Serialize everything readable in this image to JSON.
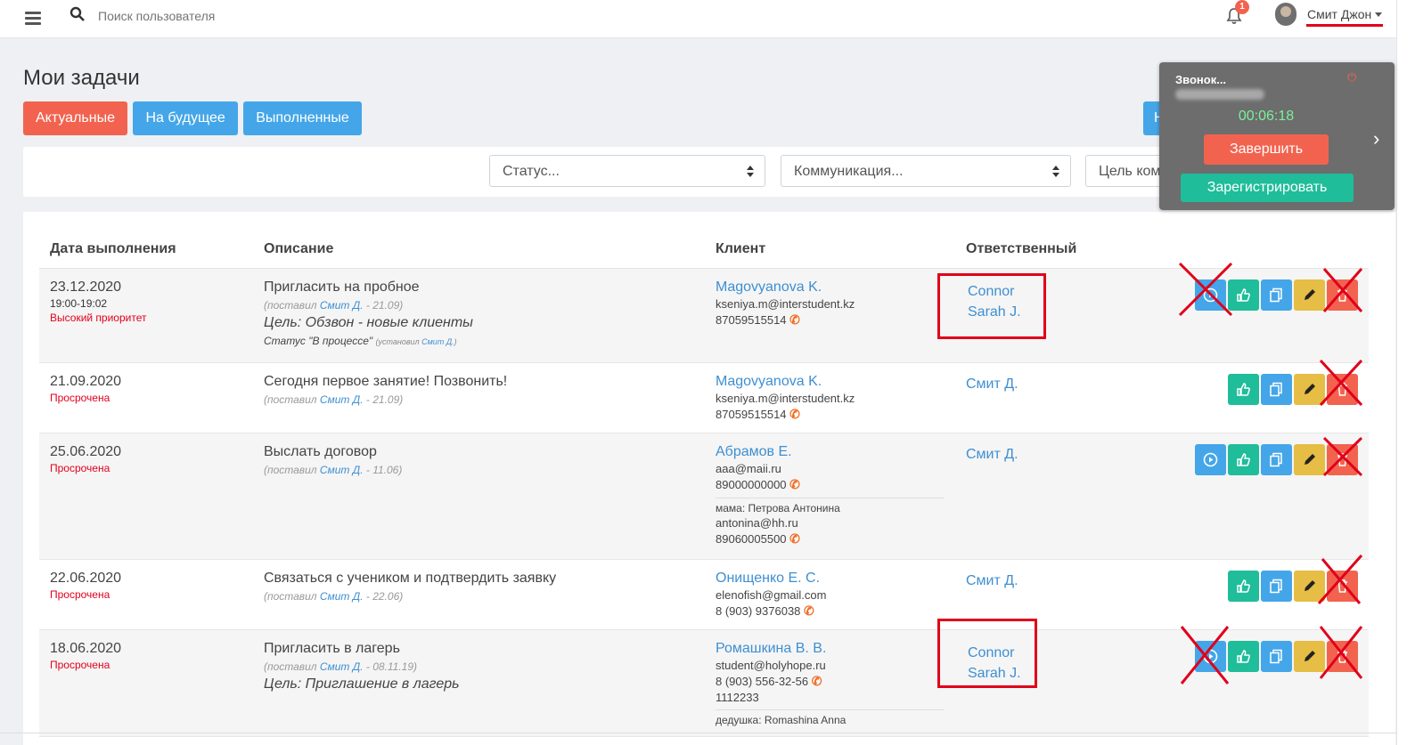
{
  "topbar": {
    "search_placeholder": "Поиск пользователя",
    "notification_count": "1",
    "username": "Смит Джон"
  },
  "page": {
    "title": "Мои задачи"
  },
  "tabs": [
    {
      "label": "Актуальные"
    },
    {
      "label": "На будущее"
    },
    {
      "label": "Выполненные"
    }
  ],
  "hidden_button_label": "Н",
  "filters": {
    "status": "Статус...",
    "communication": "Коммуникация...",
    "goal": "Цель ком"
  },
  "table": {
    "headers": {
      "date": "Дата выполнения",
      "description": "Описание",
      "client": "Клиент",
      "responsible": "Ответственный"
    },
    "rows": [
      {
        "date": "23.12.2020",
        "time": "19:00-19:02",
        "label": "Высокий приоритет",
        "desc": "Пригласить на пробное",
        "meta_prefix": "(поставил ",
        "meta_author": "Смит Д.",
        "meta_suffix": " - 21.09)",
        "goal": "Цель: Обзвон - новые клиенты",
        "status_text": "Статус \"В процессе\"",
        "status_note_prefix": "(установил ",
        "status_note_author": "Смит Д.",
        "status_note_suffix": ")",
        "client_name": "Magovyanova K.",
        "client_email": "kseniya.m@interstudent.kz",
        "client_phone": "87059515514",
        "responsible": [
          "Connor",
          "Sarah J."
        ]
      },
      {
        "date": "21.09.2020",
        "label": "Просрочена",
        "desc": "Сегодня первое занятие! Позвонить!",
        "meta_prefix": "(поставил ",
        "meta_author": "Смит Д.",
        "meta_suffix": " - 21.09)",
        "client_name": "Magovyanova K.",
        "client_email": "kseniya.m@interstudent.kz",
        "client_phone": "87059515514",
        "responsible": [
          "Смит Д."
        ]
      },
      {
        "date": "25.06.2020",
        "label": "Просрочена",
        "desc": "Выслать договор",
        "meta_prefix": "(поставил ",
        "meta_author": "Смит Д.",
        "meta_suffix": " - 11.06)",
        "client_name": "Абрамов Е.",
        "client_email": "aaa@maii.ru",
        "client_phone": "89000000000",
        "extra_contact": {
          "name": "мама: Петрова Антонина",
          "email": "antonina@hh.ru",
          "phone": "89060005500"
        },
        "responsible": [
          "Смит Д."
        ]
      },
      {
        "date": "22.06.2020",
        "label": "Просрочена",
        "desc": "Связаться с учеником и подтвердить заявку",
        "meta_prefix": "(поставил ",
        "meta_author": "Смит Д.",
        "meta_suffix": " - 22.06)",
        "client_name": "Онищенко Е. С.",
        "client_email": "elenofish@gmail.com",
        "client_phone": "8 (903) 9376038",
        "responsible": [
          "Смит Д."
        ]
      },
      {
        "date": "18.06.2020",
        "label": "Просрочена",
        "desc": "Пригласить в лагерь",
        "meta_prefix": "(поставил ",
        "meta_author": "Смит Д.",
        "meta_suffix": " - 08.11.19)",
        "goal": "Цель: Приглашение в лагерь",
        "client_name": "Ромашкина В. В.",
        "client_email": "student@holyhope.ru",
        "client_phone": "8 (903) 556-32-56",
        "client_phone2": "1112233",
        "extra_contact": {
          "name": "дедушка: Romashina Anna"
        },
        "responsible": [
          "Connor",
          "Sarah J."
        ]
      }
    ]
  },
  "call_widget": {
    "title": "Звонок...",
    "timer": "00:06:18",
    "end_label": "Завершить",
    "register_label": "Зарегистрировать"
  },
  "colors": {
    "red": "#f2634f",
    "blue": "#44a6e8",
    "green": "#1fbd9a",
    "yellow": "#e6bd45",
    "annotation_red": "#e0001a"
  },
  "icons": [
    "menu-icon",
    "search-icon",
    "bell-icon",
    "play-icon",
    "thumbs-up-icon",
    "copy-icon",
    "pencil-icon",
    "trash-icon",
    "phone-icon",
    "power-icon",
    "chevron-right-icon"
  ]
}
